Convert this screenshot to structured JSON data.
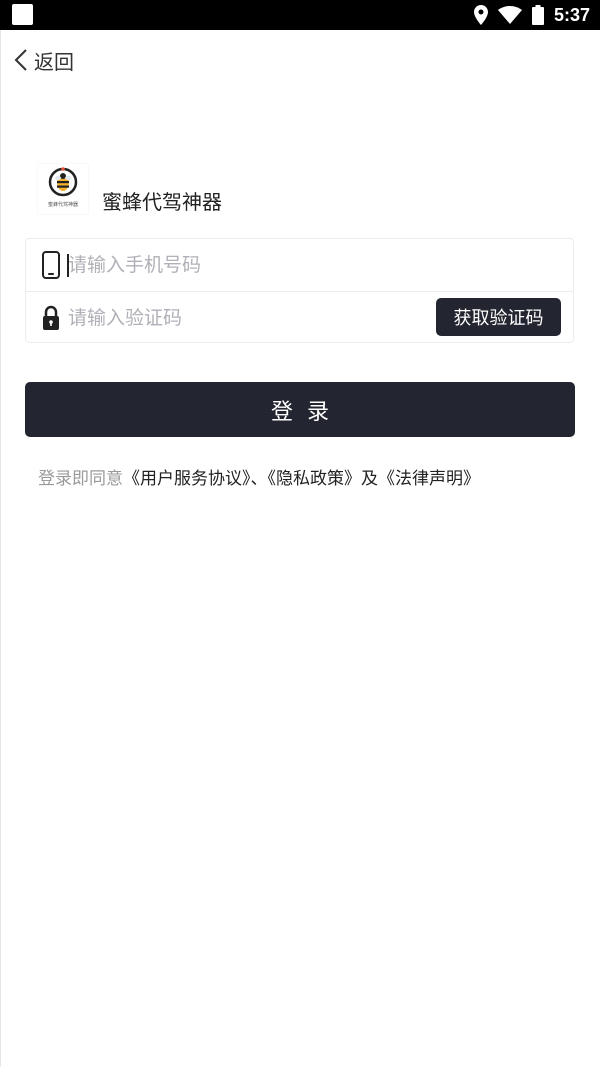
{
  "status_bar": {
    "time": "5:37",
    "icons": [
      "app-square-icon",
      "location-pin-icon",
      "wifi-icon",
      "battery-icon"
    ]
  },
  "nav": {
    "back_label": "返回",
    "back_icon": "chevron-left-icon"
  },
  "app": {
    "name": "蜜蜂代驾神器",
    "logo_icon": "bee-logo-icon",
    "logo_caption": "蜜蜂代驾神器"
  },
  "form": {
    "phone": {
      "placeholder": "请输入手机号码",
      "value": "",
      "icon": "phone-icon"
    },
    "code": {
      "placeholder": "请输入验证码",
      "value": "",
      "icon": "lock-icon",
      "get_code_label": "获取验证码"
    }
  },
  "login": {
    "label": "登录"
  },
  "agreement": {
    "prefix": "登录即同意",
    "user_agreement": "《用户服务协议》",
    "separator": "、",
    "privacy_policy": "《隐私政策》",
    "conjunction": "及",
    "legal_statement": "《法律声明》"
  },
  "colors": {
    "primary_dark": "#232530",
    "muted_text": "#9a9a9a",
    "placeholder": "#b0b0b8"
  }
}
